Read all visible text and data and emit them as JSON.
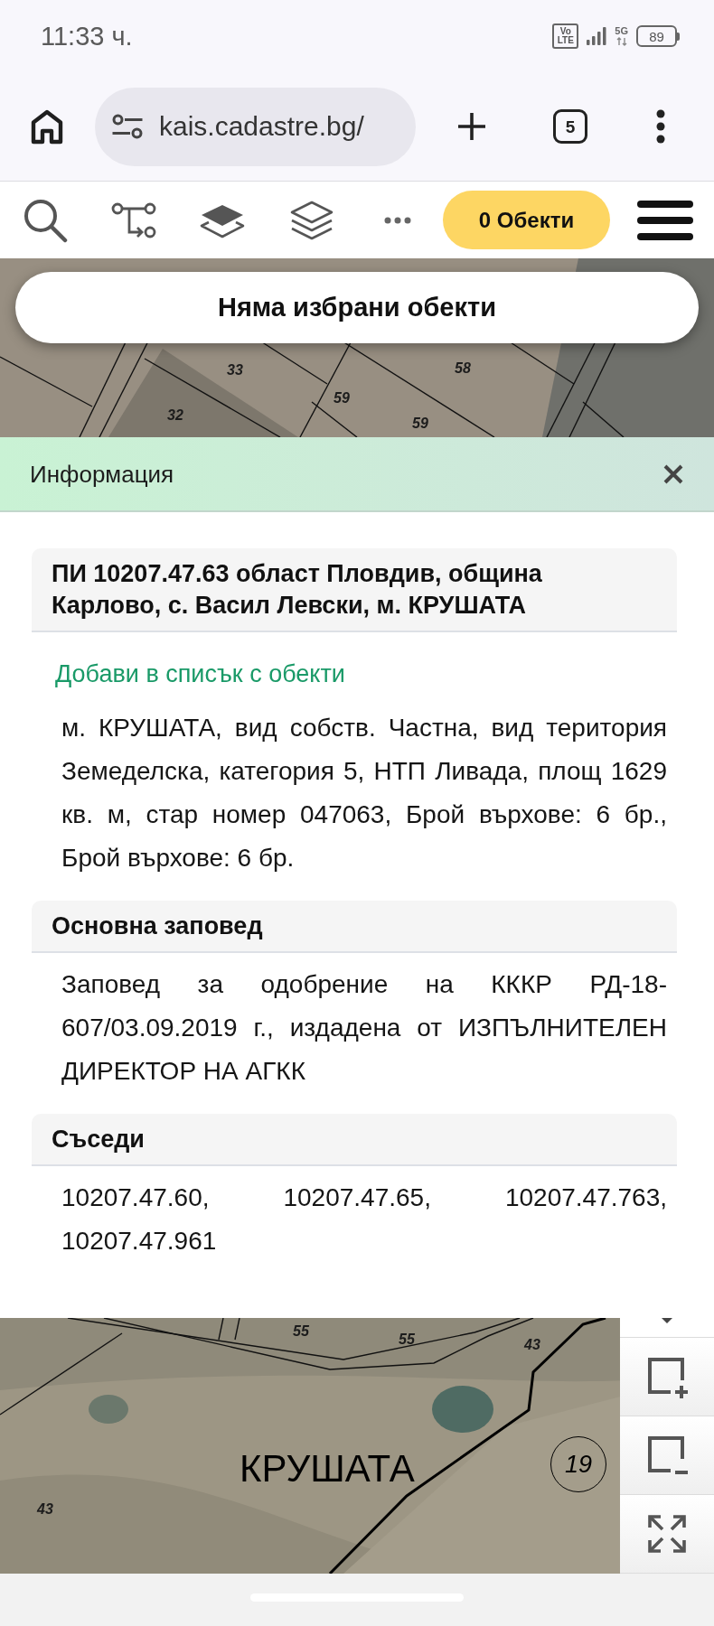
{
  "status_bar": {
    "time": "11:33 ч.",
    "network_badge": [
      "Vo",
      "LTE"
    ],
    "network_type": "5G",
    "battery": "89"
  },
  "browser": {
    "url": "kais.cadastre.bg/",
    "tab_count": "5"
  },
  "toolbar": {
    "objects_button": "0 Обекти"
  },
  "map_top": {
    "labels": [
      {
        "kind": "parcel",
        "text": "33"
      },
      {
        "kind": "parcel",
        "text": "58"
      },
      {
        "kind": "parcel",
        "text": "59"
      },
      {
        "kind": "parcel",
        "text": "32"
      },
      {
        "kind": "parcel",
        "text": "59"
      }
    ],
    "banner": "Няма избрани обекти"
  },
  "info_panel": {
    "title": "Информация",
    "sections": [
      {
        "title": "ПИ 10207.47.63 област Пловдив, община Карлово, с. Васил Левски, м. КРУШАТА",
        "link": "Добави в списък с обекти",
        "body": "м. КРУШАТА, вид собств. Частна, вид територия Земеделска, категория 5, НТП Ливада, площ 1629 кв. м, стар номер 047063, Брой върхове: 6 бр., Брой върхове: 6 бр."
      },
      {
        "title": "Основна заповед",
        "body": "Заповед за одобрение на КККР РД-18-607/03.09.2019 г., издадена от ИЗПЪЛНИТЕЛЕН ДИРЕКТОР НА АГКК"
      },
      {
        "title": "Съседи",
        "body": "10207.47.60, 10207.47.65, 10207.47.763, 10207.47.961"
      }
    ]
  },
  "map_bottom": {
    "labels": [
      {
        "kind": "parcel",
        "text": "55"
      },
      {
        "kind": "parcel",
        "text": "55"
      },
      {
        "kind": "parcel",
        "text": "43"
      },
      {
        "kind": "area",
        "text": "КРУШАТА"
      },
      {
        "kind": "circled",
        "text": "19"
      },
      {
        "kind": "parcel",
        "text": "43"
      }
    ]
  }
}
